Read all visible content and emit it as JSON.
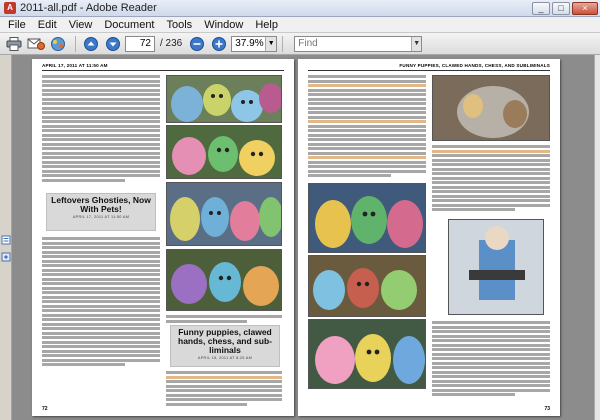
{
  "window": {
    "title": "2011-all.pdf - Adobe Reader",
    "app_icon_letter": "A",
    "controls": {
      "minimize": "_",
      "maximize": "□",
      "close": "×"
    }
  },
  "menu": [
    "File",
    "Edit",
    "View",
    "Document",
    "Tools",
    "Window",
    "Help"
  ],
  "toolbar": {
    "icons": [
      "print-icon",
      "email-icon",
      "collaborate-icon",
      "prev-page-icon",
      "next-page-icon",
      "zoom-out-icon",
      "zoom-in-icon"
    ],
    "page_current": "72",
    "page_total": "/ 236",
    "zoom": "37.9%",
    "find_placeholder": "Find"
  },
  "colors": {
    "accent": "#2a5db0",
    "page_bg": "#ffffff",
    "viewer_bg": "#8c8c8c",
    "link": "#d9a060"
  },
  "document": {
    "left_page": {
      "running_head": "APRIL 17, 2011 AT 11:50 AM",
      "folio": "72",
      "post_title_1": "Leftovers Ghosties, Now With Pets!",
      "post_date_1": "APRIL 17, 2011 AT 11:50 AM",
      "post_title_2": "Funny puppies, clawed hands, chess, and sub-liminals",
      "post_date_2": "APRIL 18, 2011 AT 8:25 AM"
    },
    "right_page": {
      "running_head": "FUNNY PUPPIES, CLAWED HANDS, CHESS, AND SUBLIMINALS",
      "folio": "73"
    }
  }
}
